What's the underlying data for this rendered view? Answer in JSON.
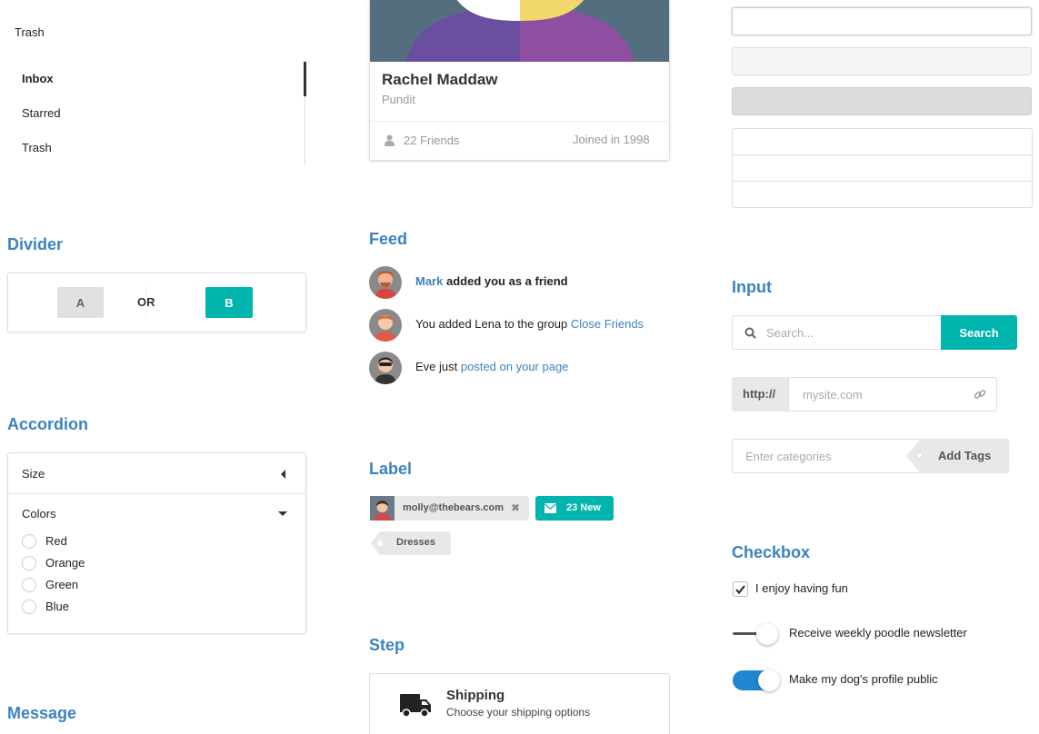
{
  "top_menu": {
    "trash_label": "Trash"
  },
  "vertical_menu": {
    "items": [
      {
        "label": "Inbox",
        "active": true
      },
      {
        "label": "Starred",
        "active": false
      },
      {
        "label": "Trash",
        "active": false
      }
    ]
  },
  "divider": {
    "title": "Divider",
    "button_a": "A",
    "or_text": "OR",
    "button_b": "B"
  },
  "accordion": {
    "title": "Accordion",
    "sections": [
      {
        "title": "Size",
        "open": false,
        "icon": "caret-left-icon"
      },
      {
        "title": "Colors",
        "open": true,
        "icon": "caret-down-icon"
      }
    ],
    "options": [
      "Red",
      "Orange",
      "Green",
      "Blue"
    ]
  },
  "message": {
    "title": "Message"
  },
  "profile_card": {
    "name": "Rachel Maddaw",
    "meta": "Pundit",
    "friends": "22 Friends",
    "joined": "Joined in 1998",
    "image_colors": {
      "background": "#546e80",
      "shirt_left": "#6a4ea0",
      "shirt_right": "#8e4fa0",
      "hair": "#f2d86b",
      "face": "#ffffff"
    }
  },
  "feed": {
    "title": "Feed",
    "events": [
      {
        "user": "Mark",
        "text": "added you as a friend",
        "link": ""
      },
      {
        "user": "",
        "text": "You added Lena to the group",
        "link": "Close Friends"
      },
      {
        "user": "",
        "text": "Eve just",
        "link": "posted on your page"
      }
    ]
  },
  "label": {
    "title": "Label",
    "image_label": "molly@thebears.com",
    "mail_label": "23 New",
    "tag_label": "Dresses"
  },
  "step": {
    "title": "Step",
    "step_title": "Shipping",
    "step_desc": "Choose your shipping options"
  },
  "input": {
    "title": "Input",
    "search_placeholder": "Search...",
    "search_button": "Search",
    "http_label": "http://",
    "url_placeholder": "mysite.com",
    "category_placeholder": "Enter categories",
    "add_tags_label": "Add Tags"
  },
  "checkbox": {
    "title": "Checkbox",
    "checkbox_label": "I enjoy having fun",
    "checkbox_checked": true,
    "slider_label": "Receive weekly poodle newsletter",
    "toggle_label": "Make my dog's profile public",
    "toggle_on": true
  },
  "colors": {
    "accent_blue": "#3b83c0",
    "teal": "#00b5ad",
    "toggle_blue": "#2185d0"
  }
}
